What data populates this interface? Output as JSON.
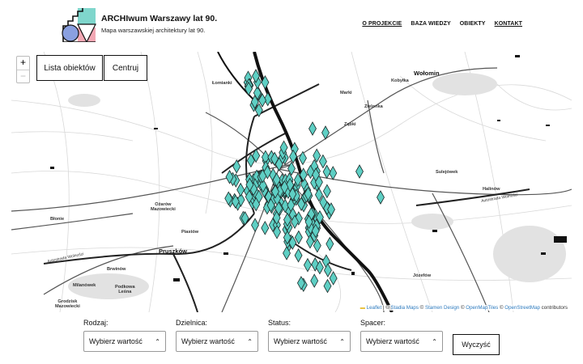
{
  "header": {
    "title": "ARCHIwum Warszawy lat 90.",
    "subtitle": "Mapa warszawskiej architektury lat 90.",
    "nav": [
      {
        "label": "O PROJEKCIE",
        "underline": true
      },
      {
        "label": "BAZA WIEDZY",
        "underline": false
      },
      {
        "label": "OBIEKTY",
        "underline": false
      },
      {
        "label": "KONTAKT",
        "underline": true
      }
    ]
  },
  "map": {
    "zoom_in": "+",
    "zoom_out": "−",
    "list_button": "Lista obiektów",
    "center_button": "Centruj",
    "marker_color": "#5ecfc4",
    "attribution": {
      "leaflet": "Leaflet",
      "sep1": " | © ",
      "stadia": "Stadia Maps",
      "sep2": " © ",
      "stamen": "Stamen Design",
      "sep3": " © ",
      "omt": "OpenMapTiles",
      "sep4": " © ",
      "osm": "OpenStreetMap",
      "tail": " contributors"
    },
    "places": {
      "wolomin": "Wołomin",
      "lomianki": "Łomianki",
      "kobylka": "Kobyłka",
      "marki": "Marki",
      "zielonka": "Zielonka",
      "zabki": "Ząbki",
      "sulejowek": "Sulejówek",
      "halinow": "Halinów",
      "blonie": "Błonie",
      "ozarow": "Ożarów\nMazowiecki",
      "piastow": "Piastów",
      "pruszkow": "Pruszków",
      "brwinow": "Brwinów",
      "milanowek": "Milanówek",
      "podkowa": "Podkowa\nLeśna",
      "grodzisk": "Grodzisk\nMazowiecki",
      "jozefow": "Józefów",
      "autostrada_w": "Autostrada Wolności",
      "autostrada_e": "Autostrada Wolności"
    }
  },
  "filters": {
    "rodzaj": {
      "label": "Rodzaj:",
      "value": "Wybierz wartość"
    },
    "dzielnica": {
      "label": "Dzielnica:",
      "value": "Wybierz wartość"
    },
    "status": {
      "label": "Status:",
      "value": "Wybierz wartość"
    },
    "spacer": {
      "label": "Spacer:",
      "value": "Wybierz wartość"
    },
    "clear_button": "Wyczyść"
  }
}
